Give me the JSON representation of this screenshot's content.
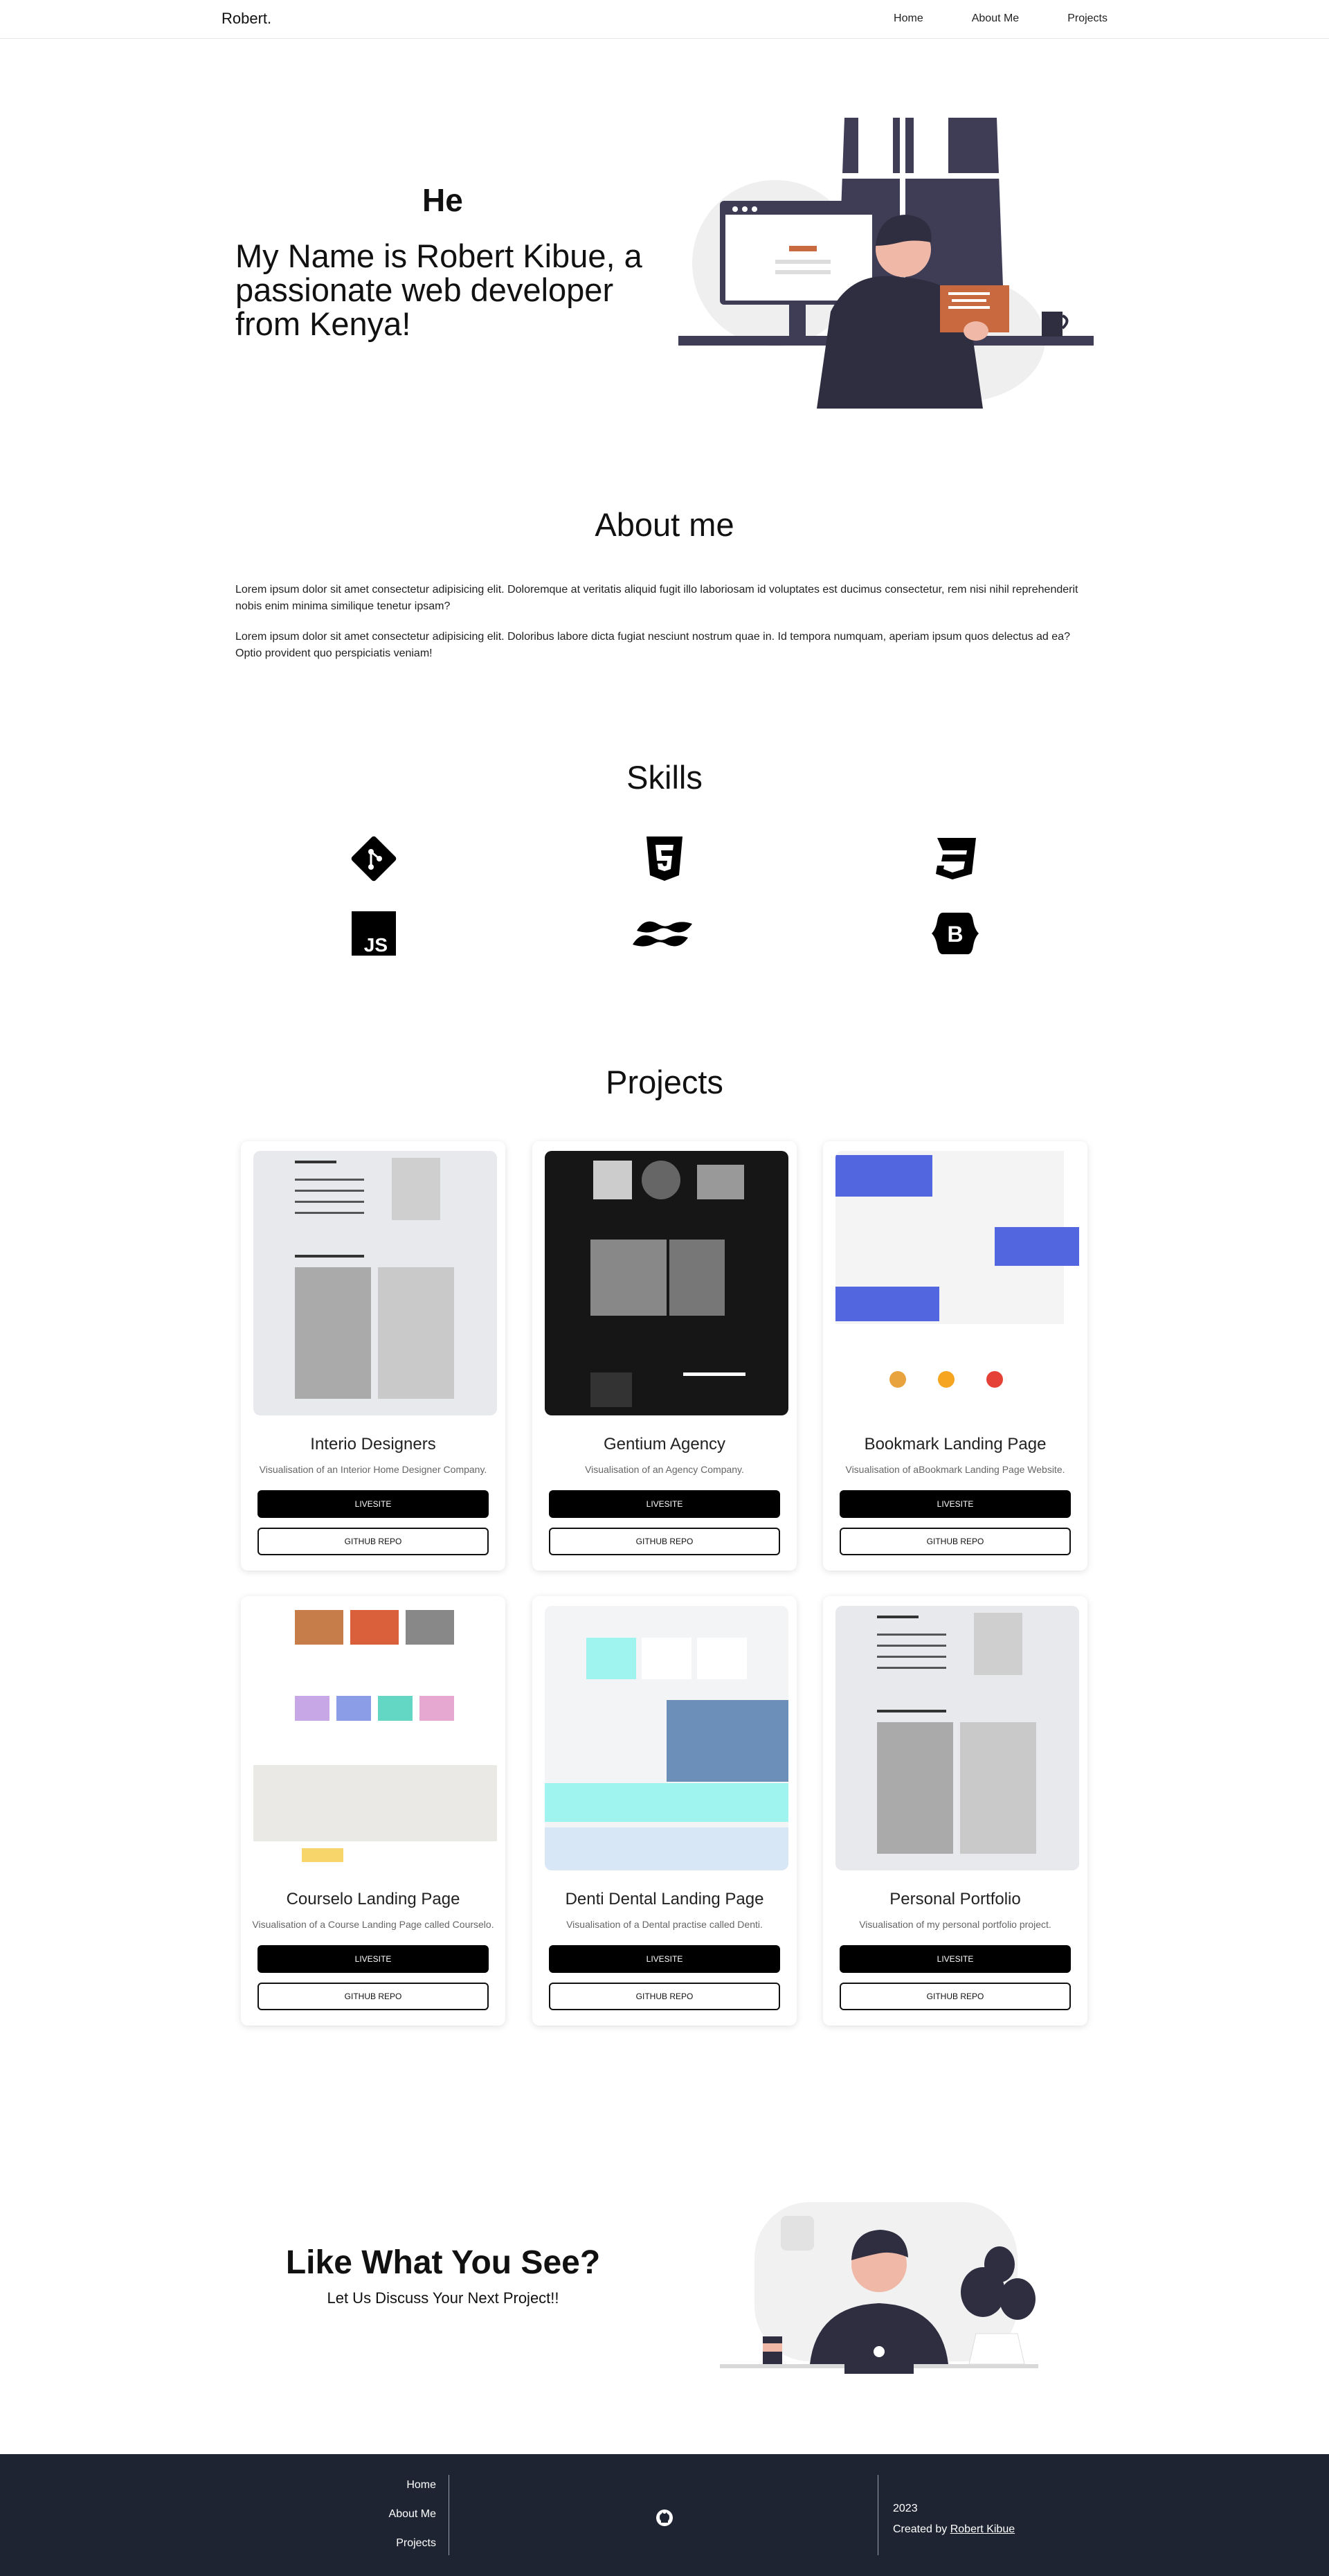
{
  "nav": {
    "brand": "Robert.",
    "links": [
      "Home",
      "About Me",
      "Projects"
    ]
  },
  "hero": {
    "greeting": "He",
    "title": "My Name is Robert Kibue, a passionate web developer from Kenya!"
  },
  "about": {
    "title": "About me",
    "paragraphs": [
      "Lorem ipsum dolor sit amet consectetur adipisicing elit. Doloremque at veritatis aliquid fugit illo laboriosam id voluptates est ducimus consectetur, rem nisi nihil reprehenderit nobis enim minima similique tenetur ipsam?",
      "Lorem ipsum dolor sit amet consectetur adipisicing elit. Doloribus labore dicta fugiat nesciunt nostrum quae in. Id tempora numquam, aperiam ipsum quos delectus ad ea? Optio provident quo perspiciatis veniam!"
    ]
  },
  "skills": {
    "title": "Skills",
    "icons": [
      "git-icon",
      "html5-icon",
      "css3-icon",
      "javascript-icon",
      "tailwind-icon",
      "bootstrap-icon"
    ]
  },
  "projects": {
    "title": "Projects",
    "live_label": "LIVESITE",
    "repo_label": "GITHUB REPO",
    "items": [
      {
        "name": "Interio Designers",
        "desc": "Visualisation of an Interior Home Designer Company."
      },
      {
        "name": "Gentium Agency",
        "desc": "Visualisation of an Agency Company."
      },
      {
        "name": "Bookmark Landing Page",
        "desc": "Visualisation of aBookmark Landing Page Website."
      },
      {
        "name": "Courselo Landing Page",
        "desc": "Visualisation of a Course Landing Page called Courselo."
      },
      {
        "name": "Denti Dental Landing Page",
        "desc": "Visualisation of a Dental practise called Denti."
      },
      {
        "name": "Personal Portfolio",
        "desc": "Visualisation of my personal portfolio project."
      }
    ]
  },
  "cta": {
    "title": "Like What You See?",
    "subtitle": "Let Us Discuss Your Next Project!!"
  },
  "footer": {
    "links": [
      "Home",
      "About Me",
      "Projects"
    ],
    "year": "2023",
    "credit_prefix": "Created by ",
    "credit_name": "Robert Kibue"
  },
  "colors": {
    "footer_bg": "#1f2433",
    "accent_dark": "#3f3d56",
    "brand_blue": "#5267df",
    "cyan": "#a0f4f0"
  }
}
